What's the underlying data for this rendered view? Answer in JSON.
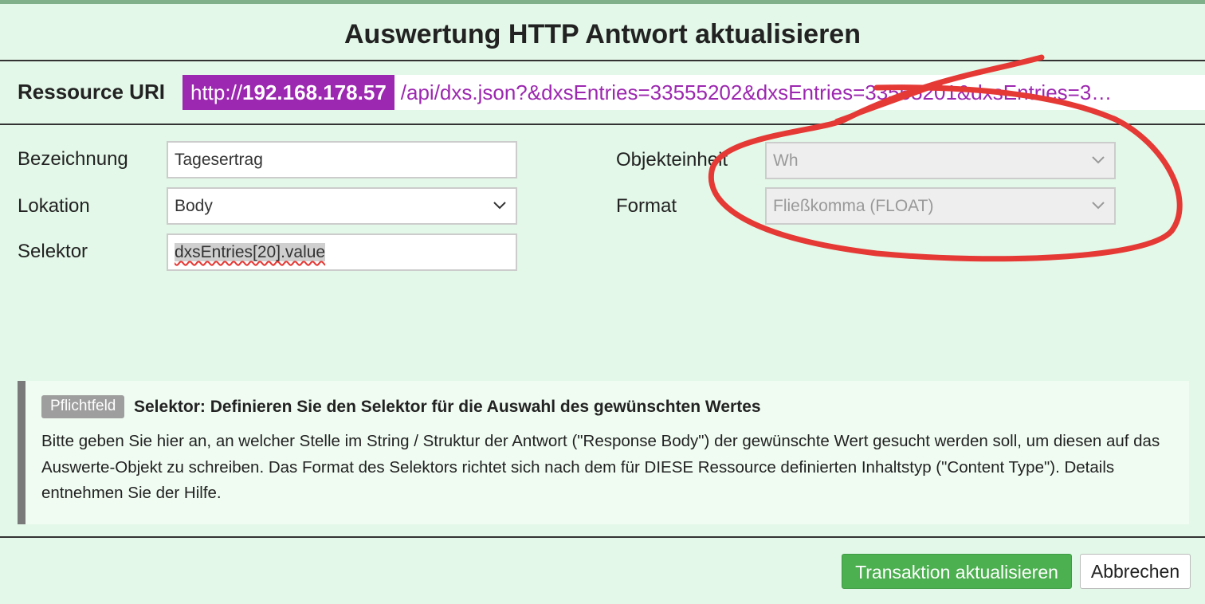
{
  "dialog": {
    "title": "Auswertung HTTP Antwort aktualisieren"
  },
  "resource": {
    "label": "Ressource URI",
    "scheme": "http://",
    "host": "192.168.178.57",
    "path": "/api/dxs.json?&dxsEntries=33555202&dxsEntries=33555201&dxsEntries=3…"
  },
  "form": {
    "bezeichnung": {
      "label": "Bezeichnung",
      "value": "Tagesertrag"
    },
    "lokation": {
      "label": "Lokation",
      "value": "Body"
    },
    "selektor": {
      "label": "Selektor",
      "value": "dxsEntries[20].value"
    },
    "objekteinheit": {
      "label": "Objekteinheit",
      "value": "Wh"
    },
    "format": {
      "label": "Format",
      "value": "Fließkomma (FLOAT)"
    }
  },
  "help": {
    "badge": "Pflichtfeld",
    "title": "Selektor: Definieren Sie den Selektor für die Auswahl des gewünschten Wertes",
    "text": "Bitte geben Sie hier an, an welcher Stelle im String / Struktur der Antwort (\"Response Body\") der gewünschte Wert gesucht werden soll, um diesen auf das Auswerte-Objekt zu schreiben. Das Format des Selektors richtet sich nach dem für DIESE Ressource definierten Inhaltstyp (\"Content Type\"). Details entnehmen Sie der Hilfe."
  },
  "footer": {
    "submit_label": "Transaktion aktualisieren",
    "cancel_label": "Abbrechen"
  },
  "colors": {
    "background": "#e3f8e8",
    "accent_purple": "#9c27b0",
    "primary_green": "#4caf50",
    "annotation_red": "#e53935"
  },
  "icons": {
    "select_arrow": "chevron-down-icon"
  }
}
